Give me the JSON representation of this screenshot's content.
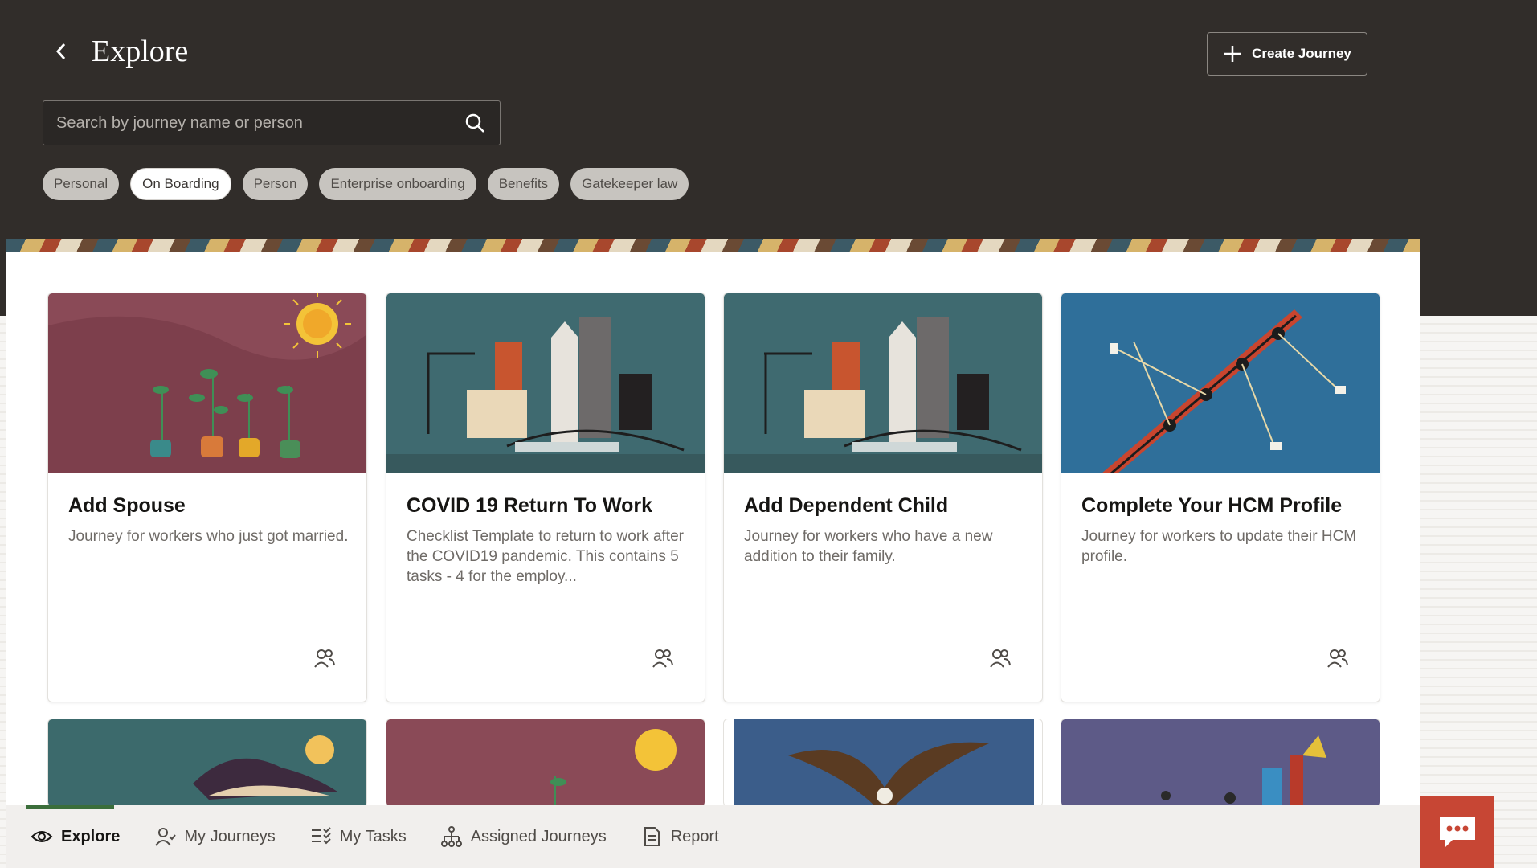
{
  "header": {
    "title": "Explore",
    "create_button_label": "Create Journey"
  },
  "search": {
    "placeholder": "Search by journey name or person"
  },
  "chips": [
    {
      "label": "Personal",
      "selected": false
    },
    {
      "label": "On Boarding",
      "selected": true
    },
    {
      "label": "Person",
      "selected": false
    },
    {
      "label": "Enterprise onboarding",
      "selected": false
    },
    {
      "label": "Benefits",
      "selected": false
    },
    {
      "label": "Gatekeeper law",
      "selected": false
    }
  ],
  "cards": [
    {
      "title": "Add Spouse",
      "description": "Journey for workers who just got married.",
      "image": "plants-sun-illustration"
    },
    {
      "title": "COVID 19 Return To Work",
      "description": "Checklist Template to return to work after the COVID19 pandemic. This contains 5 tasks - 4 for the employ...",
      "image": "city-skyline-illustration"
    },
    {
      "title": "Add Dependent Child",
      "description": "Journey for workers who have a new addition to their family.",
      "image": "city-skyline-illustration"
    },
    {
      "title": "Complete Your HCM Profile",
      "description": "Journey for workers to update their HCM profile.",
      "image": "rowing-boat-illustration"
    }
  ],
  "cards_row2": [
    {
      "image": "sleeping-person-illustration"
    },
    {
      "image": "plants-sun-illustration"
    },
    {
      "image": "eagle-photo"
    },
    {
      "image": "team-climbing-illustration"
    }
  ],
  "bottom_nav": [
    {
      "label": "Explore",
      "icon": "eye-icon",
      "active": true
    },
    {
      "label": "My Journeys",
      "icon": "person-icon",
      "active": false
    },
    {
      "label": "My Tasks",
      "icon": "tasks-icon",
      "active": false
    },
    {
      "label": "Assigned Journeys",
      "icon": "hierarchy-icon",
      "active": false
    },
    {
      "label": "Report",
      "icon": "report-icon",
      "active": false
    }
  ],
  "colors": {
    "header_bg": "#312d2a",
    "chat_button": "#c74634",
    "active_indicator": "#3b6e3b"
  }
}
